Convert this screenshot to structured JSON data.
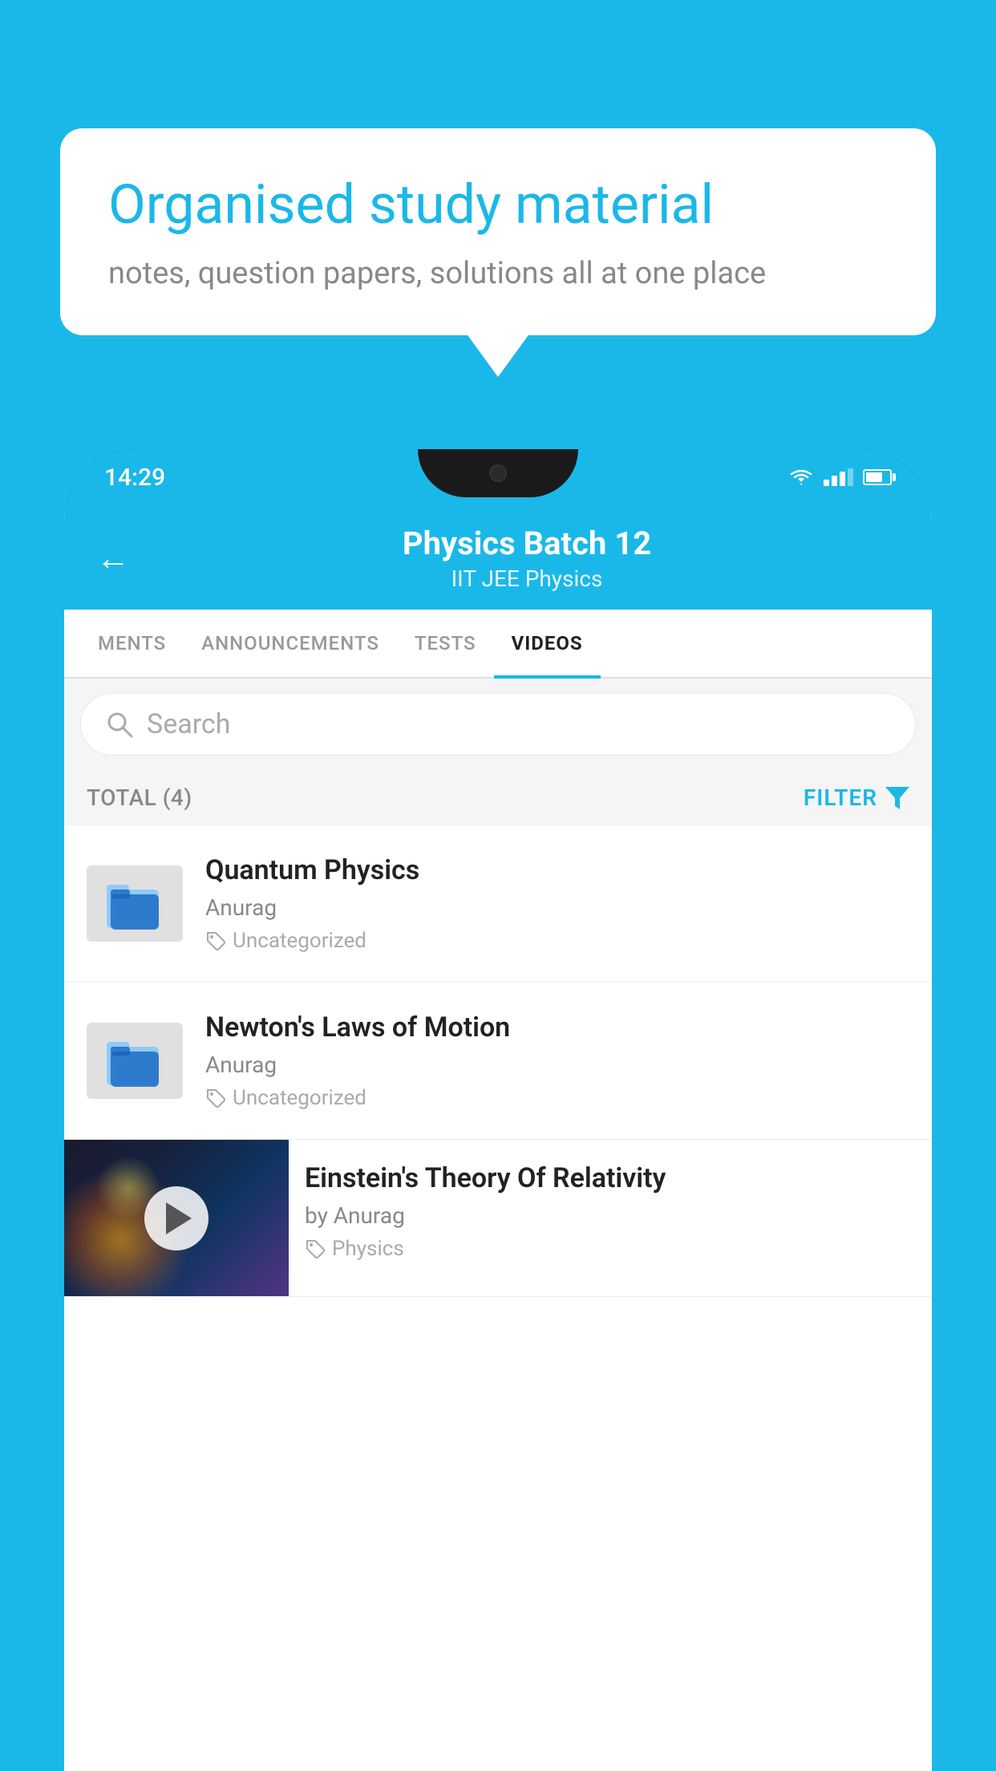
{
  "background_color": "#1ab8e8",
  "speech_bubble": {
    "title": "Organised study material",
    "subtitle": "notes, question papers, solutions all at one place"
  },
  "phone": {
    "status_bar": {
      "time": "14:29",
      "wifi": true,
      "signal": true,
      "battery": true
    },
    "app_header": {
      "title": "Physics Batch 12",
      "subtitle_tags": "IIT JEE   Physics",
      "back_label": "←"
    },
    "tabs": [
      {
        "label": "MENTS",
        "active": false
      },
      {
        "label": "ANNOUNCEMENTS",
        "active": false
      },
      {
        "label": "TESTS",
        "active": false
      },
      {
        "label": "VIDEOS",
        "active": true
      }
    ],
    "search": {
      "placeholder": "Search"
    },
    "filter_bar": {
      "total_label": "TOTAL (4)",
      "filter_label": "FILTER"
    },
    "videos": [
      {
        "title": "Quantum Physics",
        "author": "Anurag",
        "category": "Uncategorized",
        "has_thumbnail": false
      },
      {
        "title": "Newton's Laws of Motion",
        "author": "Anurag",
        "category": "Uncategorized",
        "has_thumbnail": false
      },
      {
        "title": "Einstein's Theory Of Relativity",
        "author": "by Anurag",
        "category": "Physics",
        "has_thumbnail": true
      }
    ]
  }
}
